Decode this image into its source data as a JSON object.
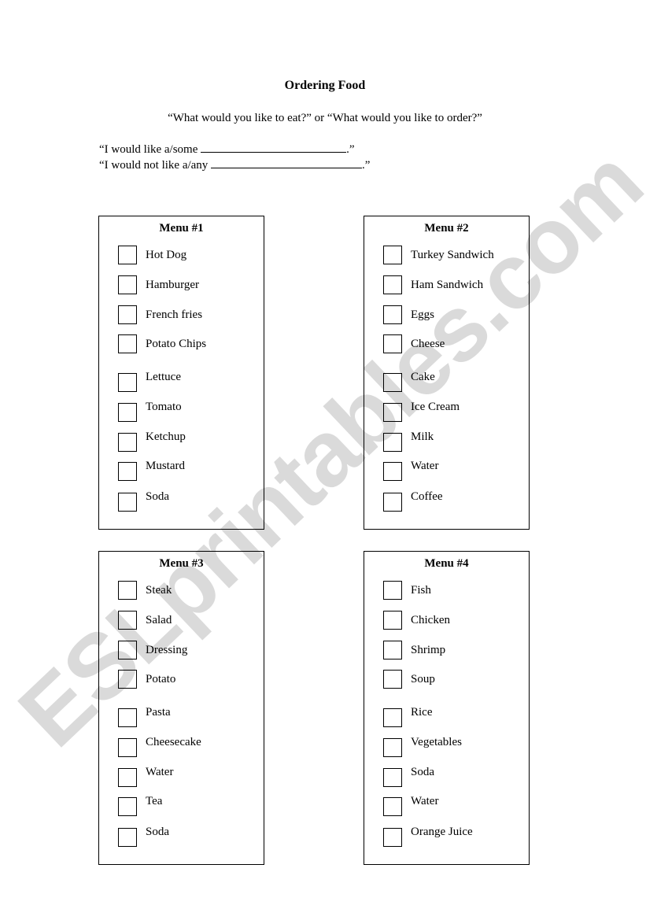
{
  "title": "Ordering Food",
  "question": "“What would you like to eat?” or  “What would you like to order?”",
  "sentences": [
    {
      "prefix": "“I would like a/some ",
      "suffix": ".”"
    },
    {
      "prefix": "“I would not like a/any ",
      "suffix": ".”"
    }
  ],
  "watermark": "ESLprintables.com",
  "menus": [
    {
      "title": "Menu #1",
      "items": [
        "Hot Dog",
        "Hamburger",
        "French fries",
        "Potato Chips",
        "Lettuce",
        "Tomato",
        "Ketchup",
        "Mustard",
        "Soda"
      ]
    },
    {
      "title": "Menu #2",
      "items": [
        "Turkey Sandwich",
        "Ham Sandwich",
        "Eggs",
        "Cheese",
        "Cake",
        "Ice Cream",
        "Milk",
        "Water",
        "Coffee"
      ]
    },
    {
      "title": "Menu #3",
      "items": [
        "Steak",
        "Salad",
        "Dressing",
        "Potato",
        "Pasta",
        "Cheesecake",
        "Water",
        "Tea",
        "Soda"
      ]
    },
    {
      "title": "Menu #4",
      "items": [
        "Fish",
        "Chicken",
        "Shrimp",
        "Soup",
        "Rice",
        "Vegetables",
        "Soda",
        "Water",
        "Orange Juice"
      ]
    }
  ]
}
